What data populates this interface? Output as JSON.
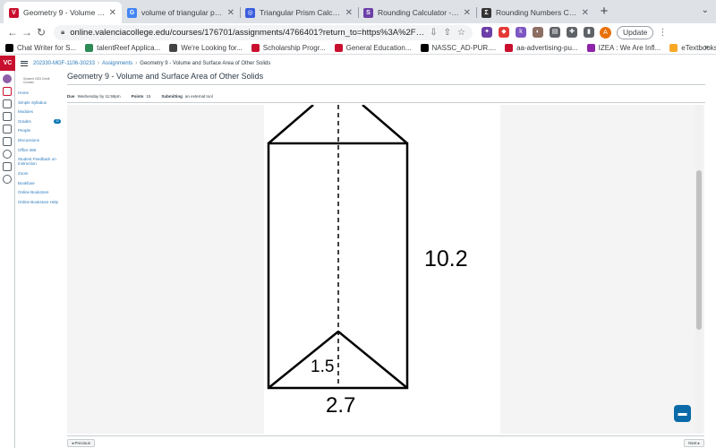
{
  "browser": {
    "tabs": [
      {
        "label": "Geometry 9 - Volume and Surfa",
        "icon": "canvas-favicon-icon",
        "color": "#c8102e",
        "glyph": "V",
        "active": true
      },
      {
        "label": "volume of triangular prism calc",
        "icon": "google-favicon-icon",
        "color": "#4285f4",
        "glyph": "G",
        "active": false
      },
      {
        "label": "Triangular Prism Calculator",
        "icon": "omni-calculator-favicon-icon",
        "color": "#3a5ddd",
        "glyph": "◎",
        "active": false
      },
      {
        "label": "Rounding Calculator - Free On",
        "icon": "symbolab-favicon-icon",
        "color": "#6c3fa8",
        "glyph": "S",
        "active": false
      },
      {
        "label": "Rounding Numbers Calculator",
        "icon": "sigma-favicon-icon",
        "color": "#333333",
        "glyph": "Σ",
        "active": false
      }
    ],
    "new_tab_glyph": "+",
    "url": "online.valenciacollege.edu/courses/176701/assignments/4766401?return_to=https%3A%2F%2Fonline.valenciacollege.edu%...",
    "update_label": "Update",
    "avatar_letter": "A",
    "bookmarks": [
      {
        "label": "Chat Writer for S...",
        "color": "#000000"
      },
      {
        "label": "talentReef Applica...",
        "color": "#2e8b57"
      },
      {
        "label": "We're Looking for...",
        "color": "#444444"
      },
      {
        "label": "Scholarship Progr...",
        "color": "#c8102e"
      },
      {
        "label": "General Education...",
        "color": "#c8102e"
      },
      {
        "label": "NASSC_AD-PUR....",
        "color": "#000000"
      },
      {
        "label": "aa-advertising-pu...",
        "color": "#c8102e"
      },
      {
        "label": "IZEA : We Are Infl...",
        "color": "#8e24aa"
      },
      {
        "label": "eTextbooks | Rent...",
        "color": "#f9a825"
      }
    ]
  },
  "canvas": {
    "breadcrumb": [
      "202330-MGF-1106-30233",
      "Assignments",
      "Geometry 9 - Volume and Surface Area of Other Solids"
    ],
    "term_label": "Summer 2023 Credit Courses",
    "course_nav": [
      "Home",
      "Simple Syllabus",
      "Modules",
      "Grades",
      "People",
      "Discussions",
      "Office 365",
      "Student Feedback on Instruction",
      "Zoom",
      "Bookfuse",
      "Online Bookstore",
      "Online Bookstore Help"
    ],
    "grades_badge": "12",
    "assignment": {
      "title": "Geometry 9 - Volume and Surface Area of Other Solids",
      "due_label": "Due",
      "due_value": "Wednesday by 11:59pm",
      "points_label": "Points",
      "points_value": "15",
      "submitting_label": "Submitting",
      "submitting_value": "an external tool"
    },
    "figure": {
      "height_label": "10.2",
      "triangle_height_label": "1.5",
      "base_label": "2.7"
    },
    "footer": {
      "previous": "◂ Previous",
      "next": "Next ▸"
    }
  },
  "colors": {
    "brand": "#c8102e",
    "link": "#2b7abc",
    "chat": "#0b6ba8"
  }
}
